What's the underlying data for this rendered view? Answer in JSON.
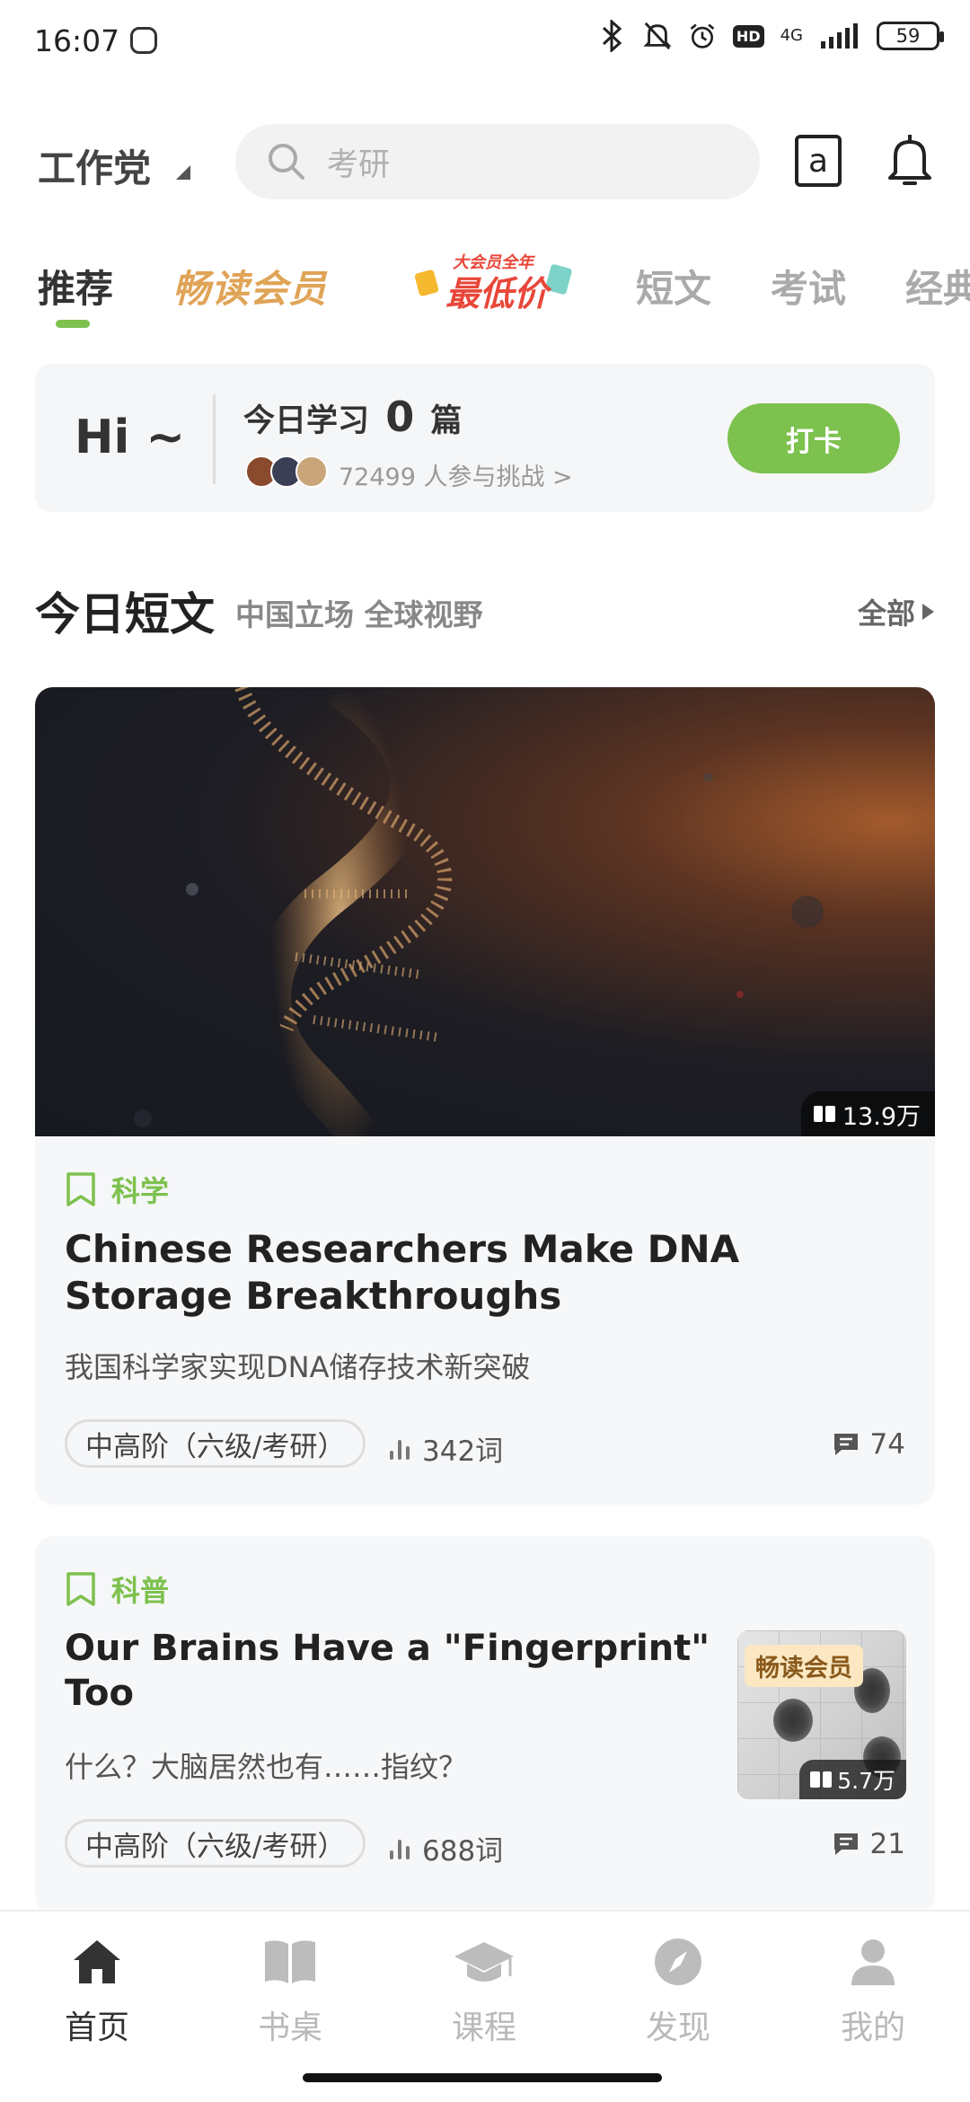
{
  "status_bar": {
    "time": "16:07",
    "network": "4G",
    "hd": "HD",
    "battery": "59"
  },
  "header": {
    "brand": "工作党",
    "search_placeholder": "考研",
    "dict_icon_letter": "a"
  },
  "tabs": [
    {
      "label": "推荐",
      "active": true
    },
    {
      "label": "畅读会员",
      "style": "vip"
    },
    {
      "label": "大会员全年最低价",
      "promo_top": "大会员全年",
      "promo_main": "最低价"
    },
    {
      "label": "短文"
    },
    {
      "label": "考试"
    },
    {
      "label": "经典"
    }
  ],
  "checkin": {
    "greeting": "Hi ~",
    "today_prefix": "今日学习",
    "today_count": "0",
    "today_suffix": "篇",
    "participants": "72499 人参与挑战 >",
    "button": "打卡"
  },
  "section": {
    "title": "今日短文",
    "subtitle": "中国立场 全球视野",
    "all": "全部"
  },
  "articles": [
    {
      "category": "科学",
      "title": "Chinese Researchers Make DNA Storage Breakthroughs",
      "subtitle": "我国科学家实现DNA储存技术新突破",
      "level": "中高阶（六级/考研）",
      "words": "342词",
      "comments": "74",
      "views": "13.9万",
      "image": "dna-helix"
    },
    {
      "category": "科普",
      "title": "Our Brains Have a \"Fingerprint\" Too",
      "subtitle": "什么？大脑居然也有……指纹？",
      "level": "中高阶（六级/考研）",
      "words": "688词",
      "comments": "21",
      "views": "5.7万",
      "badge": "畅读会员",
      "image": "fingerprint-card"
    }
  ],
  "bottom_nav": [
    {
      "label": "首页",
      "icon": "home-icon",
      "active": true
    },
    {
      "label": "书桌",
      "icon": "book-icon"
    },
    {
      "label": "课程",
      "icon": "graduation-cap-icon"
    },
    {
      "label": "发现",
      "icon": "compass-icon"
    },
    {
      "label": "我的",
      "icon": "person-icon"
    }
  ],
  "colors": {
    "accent": "#7dc14e",
    "vip": "#e0a457",
    "promo_red": "#e8473a",
    "text": "#222222",
    "muted": "#aaaaaa"
  }
}
